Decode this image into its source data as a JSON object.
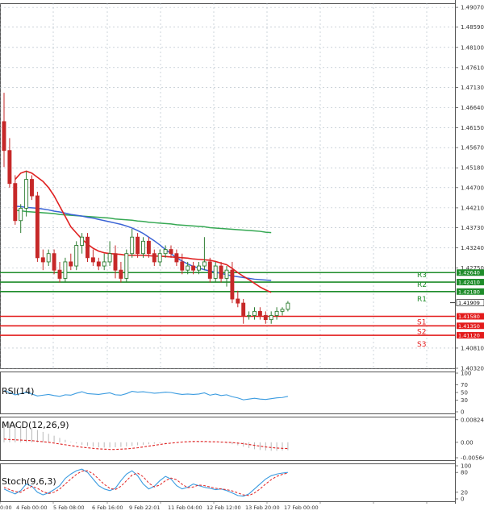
{
  "colors": {
    "bull": "#2e7d32",
    "bear": "#c62828",
    "sma_fast": "#e02020",
    "sma_mid": "#3a63d6",
    "sma_slow": "#35a853",
    "resistance": "#1e8c2a",
    "support": "#e31b1b",
    "current": "#000000",
    "rsi": "#3a9be0",
    "macd_signal": "#e02020",
    "macd_hist": "#b9b9b9",
    "stoch_k": "#3a9be0",
    "stoch_d": "#e02020",
    "grid": "#aeb9c4"
  },
  "chart_data": [
    {
      "type": "candlestick",
      "title": "",
      "ylim": [
        1.4032,
        1.4917
      ],
      "y_ticks": [
        "1.49070",
        "1.48590",
        "1.48100",
        "1.47610",
        "1.47130",
        "1.46640",
        "1.46150",
        "1.45670",
        "1.45180",
        "1.44700",
        "1.44210",
        "1.43730",
        "1.43240",
        "1.42750",
        "1.40810",
        "1.40320"
      ],
      "x_tick_labels": [
        "0:00",
        "4 Feb 00:00",
        "5 Feb 08:00",
        "6 Feb 16:00",
        "9 Feb 22:01",
        "11 Feb 04:00",
        "12 Feb 12:00",
        "13 Feb 20:00",
        "17 Feb 00:00"
      ],
      "current_price": "1.41909",
      "levels": [
        {
          "name": "R3",
          "label": "R3",
          "value": 1.4264,
          "price_label": "1.42640",
          "kind": "resistance"
        },
        {
          "name": "R2",
          "label": "R2",
          "value": 1.4241,
          "price_label": "1.42410",
          "kind": "resistance"
        },
        {
          "name": "R1",
          "label": "R1",
          "value": 1.4218,
          "price_label": "1.42180",
          "kind": "resistance"
        },
        {
          "name": "S1",
          "label": "S1",
          "value": 1.4158,
          "price_label": "1.41580",
          "kind": "support"
        },
        {
          "name": "S2",
          "label": "S2",
          "value": 1.4135,
          "price_label": "1.41350",
          "kind": "support"
        },
        {
          "name": "S3",
          "label": "S3",
          "value": 1.4112,
          "price_label": "1.41120",
          "kind": "support"
        }
      ],
      "candles": [
        [
          1.463,
          1.47,
          1.452,
          1.456
        ],
        [
          1.456,
          1.459,
          1.447,
          1.448
        ],
        [
          1.448,
          1.45,
          1.438,
          1.439
        ],
        [
          1.439,
          1.443,
          1.436,
          1.442
        ],
        [
          1.442,
          1.451,
          1.44,
          1.449
        ],
        [
          1.449,
          1.45,
          1.444,
          1.445
        ],
        [
          1.445,
          1.446,
          1.429,
          1.43
        ],
        [
          1.43,
          1.432,
          1.427,
          1.429
        ],
        [
          1.429,
          1.432,
          1.428,
          1.431
        ],
        [
          1.431,
          1.432,
          1.426,
          1.427
        ],
        [
          1.427,
          1.429,
          1.424,
          1.425
        ],
        [
          1.425,
          1.43,
          1.424,
          1.429
        ],
        [
          1.429,
          1.431,
          1.427,
          1.428
        ],
        [
          1.428,
          1.434,
          1.427,
          1.433
        ],
        [
          1.433,
          1.436,
          1.431,
          1.435
        ],
        [
          1.435,
          1.436,
          1.429,
          1.43
        ],
        [
          1.43,
          1.432,
          1.428,
          1.429
        ],
        [
          1.429,
          1.43,
          1.427,
          1.428
        ],
        [
          1.428,
          1.431,
          1.427,
          1.429
        ],
        [
          1.429,
          1.434,
          1.428,
          1.431
        ],
        [
          1.431,
          1.433,
          1.425,
          1.427
        ],
        [
          1.427,
          1.429,
          1.424,
          1.425
        ],
        [
          1.425,
          1.432,
          1.424,
          1.431
        ],
        [
          1.431,
          1.437,
          1.43,
          1.435
        ],
        [
          1.435,
          1.436,
          1.43,
          1.431
        ],
        [
          1.431,
          1.435,
          1.43,
          1.434
        ],
        [
          1.434,
          1.435,
          1.43,
          1.431
        ],
        [
          1.431,
          1.432,
          1.428,
          1.429
        ],
        [
          1.429,
          1.432,
          1.428,
          1.431
        ],
        [
          1.431,
          1.433,
          1.43,
          1.432
        ],
        [
          1.432,
          1.433,
          1.43,
          1.431
        ],
        [
          1.431,
          1.432,
          1.428,
          1.429
        ],
        [
          1.429,
          1.431,
          1.426,
          1.427
        ],
        [
          1.427,
          1.429,
          1.426,
          1.428
        ],
        [
          1.428,
          1.429,
          1.426,
          1.427
        ],
        [
          1.427,
          1.429,
          1.426,
          1.428
        ],
        [
          1.428,
          1.435,
          1.427,
          1.429
        ],
        [
          1.429,
          1.43,
          1.424,
          1.425
        ],
        [
          1.425,
          1.429,
          1.424,
          1.428
        ],
        [
          1.428,
          1.429,
          1.424,
          1.425
        ],
        [
          1.425,
          1.428,
          1.423,
          1.427
        ],
        [
          1.427,
          1.429,
          1.419,
          1.42
        ],
        [
          1.42,
          1.422,
          1.418,
          1.419
        ],
        [
          1.419,
          1.42,
          1.414,
          1.416
        ],
        [
          1.416,
          1.417,
          1.415,
          1.416
        ],
        [
          1.416,
          1.418,
          1.415,
          1.417
        ],
        [
          1.417,
          1.418,
          1.415,
          1.416
        ],
        [
          1.416,
          1.417,
          1.414,
          1.415
        ],
        [
          1.415,
          1.417,
          1.414,
          1.416
        ],
        [
          1.416,
          1.418,
          1.415,
          1.417
        ],
        [
          1.417,
          1.418,
          1.416,
          1.4175
        ],
        [
          1.4175,
          1.4195,
          1.417,
          1.419
        ]
      ],
      "sma_fast": [
        null,
        null,
        1.449,
        1.4505,
        1.451,
        1.4505,
        1.4495,
        1.4485,
        1.447,
        1.445,
        1.4425,
        1.44,
        1.4375,
        1.436,
        1.4345,
        1.4333,
        1.4323,
        1.4316,
        1.4312,
        1.431,
        1.4309,
        1.4308,
        1.4306,
        1.4306,
        1.4306,
        1.4306,
        1.4305,
        1.4304,
        1.4304,
        1.4303,
        1.4302,
        1.4301,
        1.43,
        1.4299,
        1.4297,
        1.4296,
        1.4295,
        1.4294,
        1.4291,
        1.4287,
        1.4283,
        1.4274,
        1.4264,
        1.4255,
        1.4247,
        1.4238,
        1.4229,
        1.4222,
        1.4216,
        null,
        null,
        null
      ],
      "sma_mid": [
        null,
        null,
        1.4425,
        1.4424,
        1.4422,
        1.4421,
        1.442,
        1.4418,
        1.4416,
        1.4413,
        1.4411,
        1.4408,
        1.4405,
        1.4403,
        1.4401,
        1.4398,
        1.4396,
        1.4393,
        1.439,
        1.4387,
        1.4384,
        1.4381,
        1.4377,
        1.4372,
        1.4366,
        1.4359,
        1.435,
        1.4341,
        1.4331,
        1.432,
        1.431,
        1.43,
        1.4292,
        1.4285,
        1.4279,
        1.4275,
        1.4271,
        1.4268,
        1.4265,
        1.4262,
        1.4259,
        1.4256,
        1.4254,
        1.4252,
        1.425,
        1.4248,
        1.4247,
        1.4246,
        1.4245,
        null,
        null,
        null
      ],
      "sma_slow": [
        null,
        null,
        1.4415,
        1.4414,
        1.4412,
        1.4411,
        1.441,
        1.4409,
        1.4408,
        1.4407,
        1.4405,
        1.4404,
        1.4403,
        1.4402,
        1.4401,
        1.44,
        1.4399,
        1.4398,
        1.4397,
        1.4396,
        1.4394,
        1.4393,
        1.4392,
        1.4391,
        1.4389,
        1.4388,
        1.4386,
        1.4385,
        1.4384,
        1.4383,
        1.4382,
        1.438,
        1.4379,
        1.4378,
        1.4377,
        1.4376,
        1.4375,
        1.4373,
        1.4372,
        1.4371,
        1.437,
        1.4369,
        1.4368,
        1.4367,
        1.4366,
        1.4365,
        1.4364,
        1.4362,
        1.4361,
        null,
        null,
        null
      ]
    },
    {
      "type": "line",
      "title": "RSI(14)",
      "ylim": [
        0,
        100
      ],
      "y_ticks": [
        "100",
        "70",
        "50",
        "30",
        "0"
      ],
      "series": [
        {
          "name": "RSI(14)",
          "values": [
            55,
            50,
            44,
            47,
            50,
            46,
            41,
            43,
            45,
            42,
            40,
            44,
            43,
            48,
            52,
            47,
            46,
            45,
            47,
            49,
            44,
            43,
            47,
            53,
            51,
            52,
            50,
            48,
            49,
            51,
            50,
            47,
            45,
            46,
            45,
            46,
            49,
            43,
            46,
            42,
            44,
            39,
            36,
            31,
            33,
            35,
            33,
            32,
            34,
            36,
            37,
            40
          ]
        }
      ]
    },
    {
      "type": "bar",
      "title": "MACD(12,26,9)",
      "ylim": [
        -0.00564,
        0.00848
      ],
      "y_ticks": [
        "0.008248",
        "0.00",
        "-0.005643"
      ],
      "series": [
        {
          "name": "histogram",
          "values": [
            0.0075,
            0.0072,
            0.0068,
            0.0063,
            0.0058,
            0.0052,
            0.0045,
            0.0038,
            0.0031,
            0.0024,
            0.0016,
            0.0009,
            0.0002,
            -0.0004,
            -0.0009,
            -0.0013,
            -0.0016,
            -0.0018,
            -0.0019,
            -0.0019,
            -0.0018,
            -0.0017,
            -0.0015,
            -0.0013,
            -0.0011,
            -0.0009,
            -0.0007,
            -0.0005,
            -0.0003,
            -0.0002,
            -0.0001,
            0.0,
            0.0001,
            0.0001,
            0.0002,
            0.0002,
            0.0002,
            0.0001,
            0.0,
            -0.0002,
            -0.0004,
            -0.0007,
            -0.0011,
            -0.0016,
            -0.0021,
            -0.0025,
            -0.0028,
            -0.003,
            -0.0031,
            -0.0031,
            -0.003,
            -0.0029
          ]
        },
        {
          "name": "signal",
          "values": [
            0.0012,
            0.001,
            0.0009,
            0.0008,
            0.0007,
            0.0006,
            0.0004,
            0.0002,
            0.0,
            -0.0003,
            -0.0006,
            -0.0009,
            -0.0012,
            -0.0015,
            -0.0018,
            -0.002,
            -0.0022,
            -0.0024,
            -0.0025,
            -0.0026,
            -0.0026,
            -0.0025,
            -0.0024,
            -0.0022,
            -0.002,
            -0.0017,
            -0.0014,
            -0.0011,
            -0.0008,
            -0.0005,
            -0.0003,
            -0.0001,
            0.0001,
            0.0002,
            0.0003,
            0.0003,
            0.0003,
            0.0002,
            0.0002,
            0.0001,
            0.0,
            -0.0001,
            -0.0003,
            -0.0005,
            -0.0008,
            -0.0011,
            -0.0014,
            -0.0017,
            -0.0019,
            -0.0021,
            -0.0022,
            -0.0023
          ]
        }
      ]
    },
    {
      "type": "line",
      "title": "Stoch(9,6,3)",
      "ylim": [
        0,
        100
      ],
      "y_ticks": [
        "100",
        "80",
        "20",
        "0"
      ],
      "series": [
        {
          "name": "%K",
          "values": [
            30,
            22,
            15,
            25,
            45,
            38,
            20,
            12,
            18,
            28,
            40,
            62,
            75,
            85,
            90,
            80,
            60,
            40,
            30,
            25,
            32,
            55,
            75,
            85,
            70,
            45,
            30,
            38,
            55,
            68,
            60,
            40,
            30,
            35,
            45,
            40,
            35,
            32,
            28,
            30,
            25,
            18,
            10,
            8,
            15,
            30,
            45,
            60,
            70,
            75,
            78,
            80
          ]
        },
        {
          "name": "%D",
          "values": [
            35,
            28,
            22,
            20,
            30,
            38,
            32,
            22,
            16,
            20,
            30,
            45,
            60,
            74,
            84,
            85,
            76,
            60,
            44,
            32,
            28,
            38,
            55,
            72,
            78,
            67,
            48,
            36,
            42,
            55,
            63,
            58,
            44,
            34,
            36,
            42,
            40,
            36,
            32,
            30,
            28,
            24,
            18,
            12,
            10,
            18,
            30,
            45,
            58,
            68,
            74,
            78
          ]
        }
      ]
    }
  ]
}
